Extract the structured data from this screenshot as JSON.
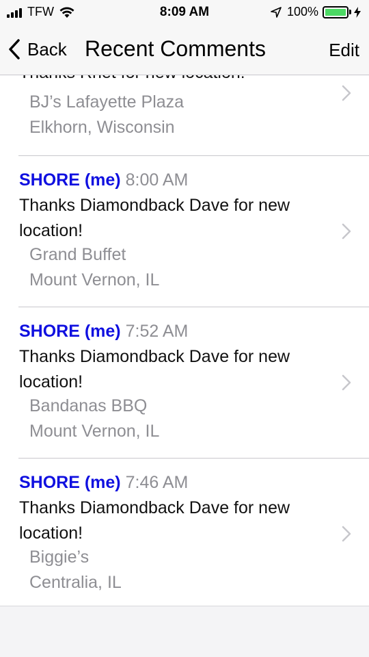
{
  "status_bar": {
    "carrier": "TFW",
    "time": "8:09 AM",
    "battery": "100%",
    "battery_color": "#4cd964"
  },
  "nav": {
    "back_label": "Back",
    "title": "Recent Comments",
    "edit_label": "Edit"
  },
  "comments": [
    {
      "user": "",
      "time": "",
      "text": "Thanks Rnet for new location!",
      "place": "BJ’s Lafayette Plaza",
      "location": "Elkhorn, Wisconsin"
    },
    {
      "user": "SHORE (me)",
      "time": "8:00 AM",
      "text": "Thanks Diamondback Dave for new location!",
      "place": "Grand Buffet",
      "location": "Mount Vernon, IL"
    },
    {
      "user": "SHORE (me)",
      "time": "7:52 AM",
      "text": "Thanks Diamondback Dave for new location!",
      "place": "Bandanas BBQ",
      "location": "Mount Vernon, IL"
    },
    {
      "user": "SHORE (me)",
      "time": "7:46 AM",
      "text": "Thanks Diamondback Dave for new location!",
      "place": "Biggie’s",
      "location": "Centralia, IL"
    }
  ],
  "colors": {
    "user_accent": "#1010e0",
    "secondary_text": "#8e8e93",
    "separator": "#c8c7cc"
  },
  "icons": [
    "signal-icon",
    "wifi-icon",
    "location-arrow-icon",
    "battery-icon",
    "charging-bolt-icon",
    "back-chevron-icon",
    "disclosure-chevron-icon"
  ]
}
